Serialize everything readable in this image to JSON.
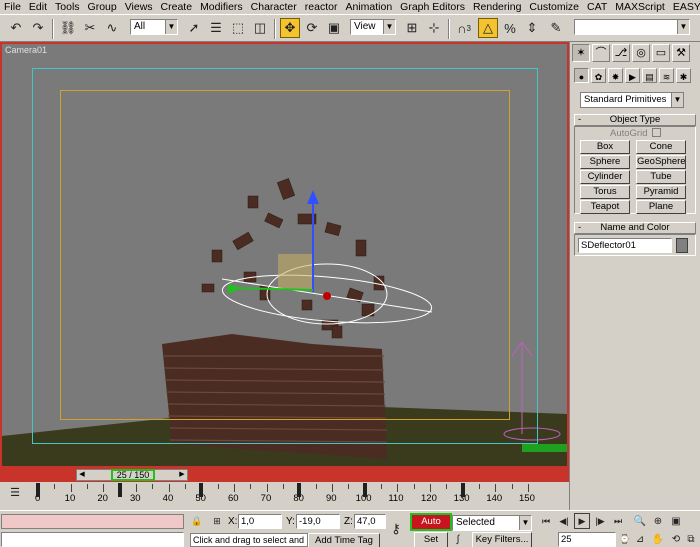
{
  "menu": [
    "File",
    "Edit",
    "Tools",
    "Group",
    "Views",
    "Create",
    "Modifiers",
    "Character",
    "reactor",
    "Animation",
    "Graph Editors",
    "Rendering",
    "Customize",
    "CAT",
    "MAXScript",
    "EASYnat"
  ],
  "toolbar": {
    "selection_filter": "All",
    "reference_coord": "View",
    "snap_label": "3",
    "named_selection": ""
  },
  "viewport": {
    "label": "Camera01",
    "colors": {
      "border": "#c8342a",
      "background": "#7a7a7a",
      "floor": "#3a3a1c",
      "brick": "#4a2c22",
      "safe_frame_outer": "#40c8c8",
      "safe_frame_inner": "#d0a030"
    }
  },
  "time_slider": {
    "value": "25 / 150"
  },
  "trackbar": {
    "ticks": [
      "0",
      "10",
      "20",
      "30",
      "40",
      "50",
      "60",
      "70",
      "80",
      "90",
      "100",
      "110",
      "120",
      "130",
      "140",
      "150"
    ],
    "keys": [
      0,
      25,
      50,
      80,
      100,
      130
    ]
  },
  "status": {
    "prompt": "Click and drag to select and mov",
    "add_time_tag": "Add Time Tag",
    "x_label": "X:",
    "x_value": "1,0",
    "y_label": "Y:",
    "y_value": "-19,0",
    "z_label": "Z:",
    "z_value": "47,0",
    "auto_key": "Auto Key",
    "set_key": "Set Key",
    "selected": "Selected",
    "key_filters": "Key Filters...",
    "frame": "25"
  },
  "panel": {
    "category": "Standard Primitives",
    "object_type_title": "Object Type",
    "autogrid": "AutoGrid",
    "buttons": [
      "Box",
      "Cone",
      "Sphere",
      "GeoSphere",
      "Cylinder",
      "Tube",
      "Torus",
      "Pyramid",
      "Teapot",
      "Plane"
    ],
    "name_color_title": "Name and Color",
    "object_name": "SDeflector01",
    "object_color": "#808080"
  }
}
